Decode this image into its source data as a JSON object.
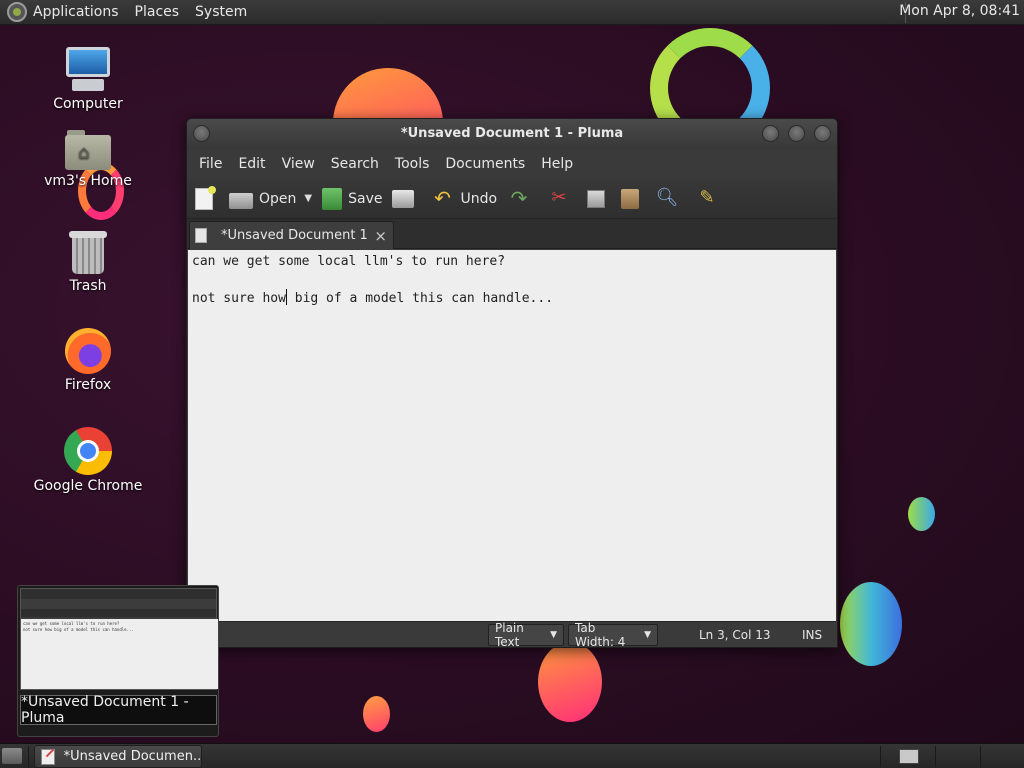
{
  "top_panel": {
    "menus": [
      "Applications",
      "Places",
      "System"
    ],
    "clock": "Mon Apr  8, 08:41"
  },
  "desktop_icons": [
    {
      "label": "Computer",
      "icon": "computer-icon"
    },
    {
      "label": "vm3's Home",
      "icon": "home-folder-icon"
    },
    {
      "label": "Trash",
      "icon": "trash-icon"
    },
    {
      "label": "Firefox",
      "icon": "firefox-icon"
    },
    {
      "label": "Google Chrome",
      "icon": "chrome-icon"
    }
  ],
  "window": {
    "title": "*Unsaved Document 1 - Pluma",
    "menu": [
      "File",
      "Edit",
      "View",
      "Search",
      "Tools",
      "Documents",
      "Help"
    ],
    "toolbar": {
      "open_label": "Open",
      "save_label": "Save",
      "undo_label": "Undo"
    },
    "tab": {
      "name": "*Unsaved Document 1",
      "close": "×"
    },
    "editor_lines": [
      "can we get some local llm's to run here?",
      "",
      "not sure how big of a model this can handle..."
    ],
    "status": {
      "language": "Plain Text",
      "tab_width": "Tab Width:  4",
      "position": "Ln 3, Col 13",
      "mode": "INS"
    }
  },
  "preview": {
    "label": "*Unsaved Document 1 - Pluma"
  },
  "taskbar": {
    "task_label": "*Unsaved Documen..."
  },
  "colors": {
    "desktop_bg": "#2a0c22",
    "panel_bg": "#2b2b2b",
    "editor_bg": "#eeeeee"
  }
}
